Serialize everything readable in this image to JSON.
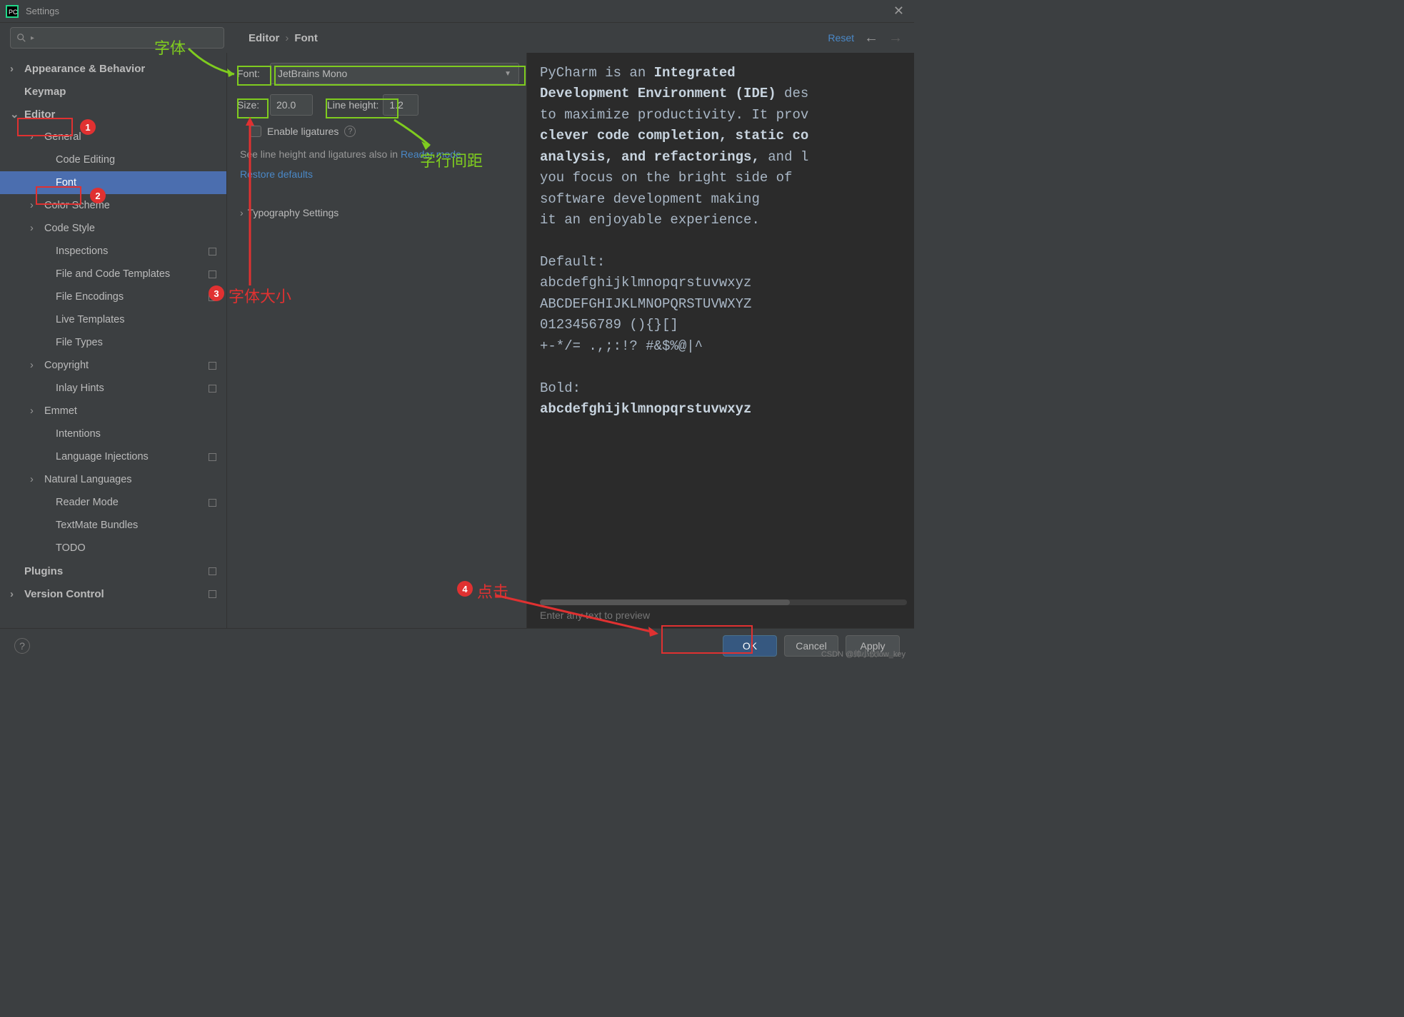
{
  "window": {
    "title": "Settings"
  },
  "breadcrumb": {
    "root": "Editor",
    "leaf": "Font"
  },
  "header": {
    "reset": "Reset"
  },
  "sidebar": {
    "items": [
      {
        "label": "Appearance & Behavior",
        "level": 1,
        "chev": "›"
      },
      {
        "label": "Keymap",
        "level": 1,
        "chev": ""
      },
      {
        "label": "Editor",
        "level": 1,
        "chev": "⌄"
      },
      {
        "label": "General",
        "level": 2,
        "chev": "›"
      },
      {
        "label": "Code Editing",
        "level": 3,
        "chev": ""
      },
      {
        "label": "Font",
        "level": 3,
        "chev": "",
        "sel": true
      },
      {
        "label": "Color Scheme",
        "level": 2,
        "chev": "›"
      },
      {
        "label": "Code Style",
        "level": 2,
        "chev": "›"
      },
      {
        "label": "Inspections",
        "level": 3,
        "chev": "",
        "sq": true
      },
      {
        "label": "File and Code Templates",
        "level": 3,
        "chev": "",
        "sq": true
      },
      {
        "label": "File Encodings",
        "level": 3,
        "chev": "",
        "sq": true
      },
      {
        "label": "Live Templates",
        "level": 3,
        "chev": ""
      },
      {
        "label": "File Types",
        "level": 3,
        "chev": ""
      },
      {
        "label": "Copyright",
        "level": 2,
        "chev": "›",
        "sq": true
      },
      {
        "label": "Inlay Hints",
        "level": 3,
        "chev": "",
        "sq": true
      },
      {
        "label": "Emmet",
        "level": 2,
        "chev": "›"
      },
      {
        "label": "Intentions",
        "level": 3,
        "chev": ""
      },
      {
        "label": "Language Injections",
        "level": 3,
        "chev": "",
        "sq": true
      },
      {
        "label": "Natural Languages",
        "level": 2,
        "chev": "›"
      },
      {
        "label": "Reader Mode",
        "level": 3,
        "chev": "",
        "sq": true
      },
      {
        "label": "TextMate Bundles",
        "level": 3,
        "chev": ""
      },
      {
        "label": "TODO",
        "level": 3,
        "chev": ""
      },
      {
        "label": "Plugins",
        "level": 1,
        "chev": "",
        "sq": true
      },
      {
        "label": "Version Control",
        "level": 1,
        "chev": "›",
        "sq": true
      }
    ]
  },
  "form": {
    "font_label": "Font:",
    "font_value": "JetBrains Mono",
    "size_label": "Size:",
    "size_value": "20.0",
    "lh_label": "Line height:",
    "lh_value": "1.2",
    "ligatures": "Enable ligatures",
    "hint_pre": "See line height and ligatures also in ",
    "hint_link": "Reader mode",
    "restore": "Restore defaults",
    "typo": "Typography Settings"
  },
  "preview": {
    "l1a": "PyCharm is an ",
    "l1b": "Integrated",
    "l2a": "Development Environment (IDE)",
    "l2b": " des",
    "l3": "to maximize productivity. It prov",
    "l4a": "clever code completion, static co",
    "l5a": "analysis, and refactorings,",
    "l5b": " and l",
    "l6": "you focus on the bright side of ",
    "l7": "software development making",
    "l8": "it an enjoyable experience.",
    "l10": "Default:",
    "l11": "abcdefghijklmnopqrstuvwxyz",
    "l12": "ABCDEFGHIJKLMNOPQRSTUVWXYZ",
    "l13": " 0123456789 (){}[]",
    "l14": " +-*/= .,;:!? #&$%@|^",
    "l16": "Bold:",
    "l17": "abcdefghijklmnopqrstuvwxyz",
    "placeholder": "Enter any text to preview"
  },
  "footer": {
    "ok": "OK",
    "cancel": "Cancel",
    "apply": "Apply"
  },
  "annotations": {
    "a1": "字体",
    "a2": "字行间距",
    "a3": "字体大小",
    "a4": "点击",
    "b1": "1",
    "b2": "2",
    "b3": "3",
    "b4": "4"
  },
  "watermark": "CSDN @帅小伙low_key"
}
